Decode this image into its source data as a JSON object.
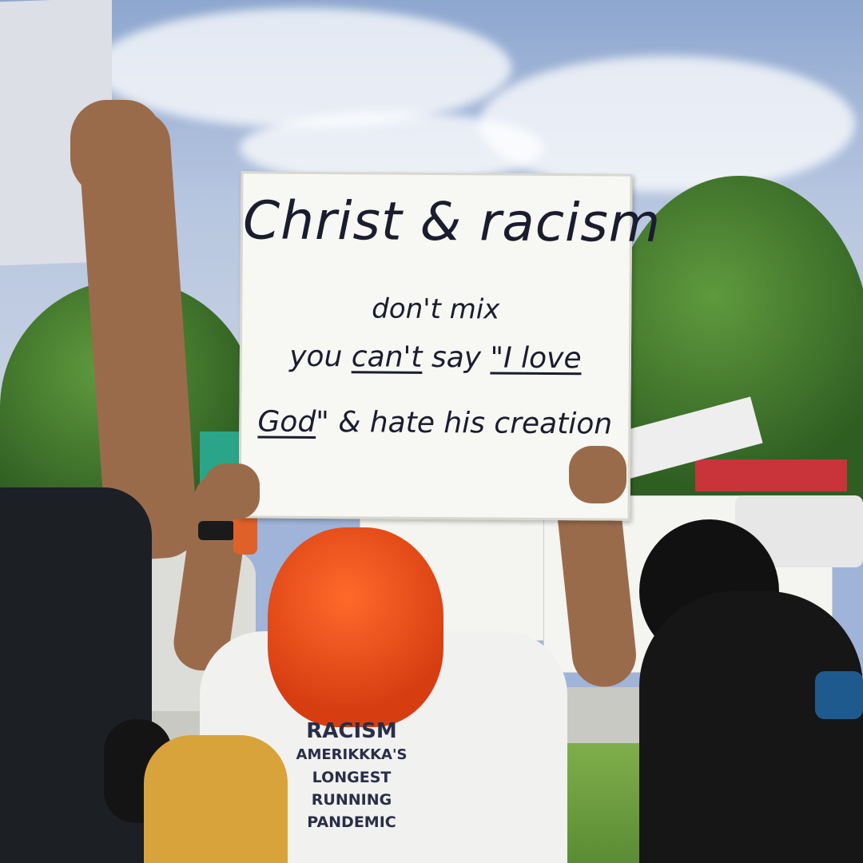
{
  "sign": {
    "line1": "Christ & racism",
    "line2": "don't mix",
    "line3_a": "you ",
    "line3_b": "can't",
    "line3_c": " say ",
    "line3_d": "\"I love",
    "line4_a": "God",
    "line4_b": "\" & hate his creation"
  },
  "shirt": {
    "line1": "RACISM",
    "line2": "AMERIKKKA'S",
    "line3": "LONGEST",
    "line4": "RUNNING",
    "line5": "PANDEMIC"
  },
  "colors": {
    "hair": "#e24a1b",
    "sky": "#9fb4d8",
    "grass": "#6f9f40"
  }
}
